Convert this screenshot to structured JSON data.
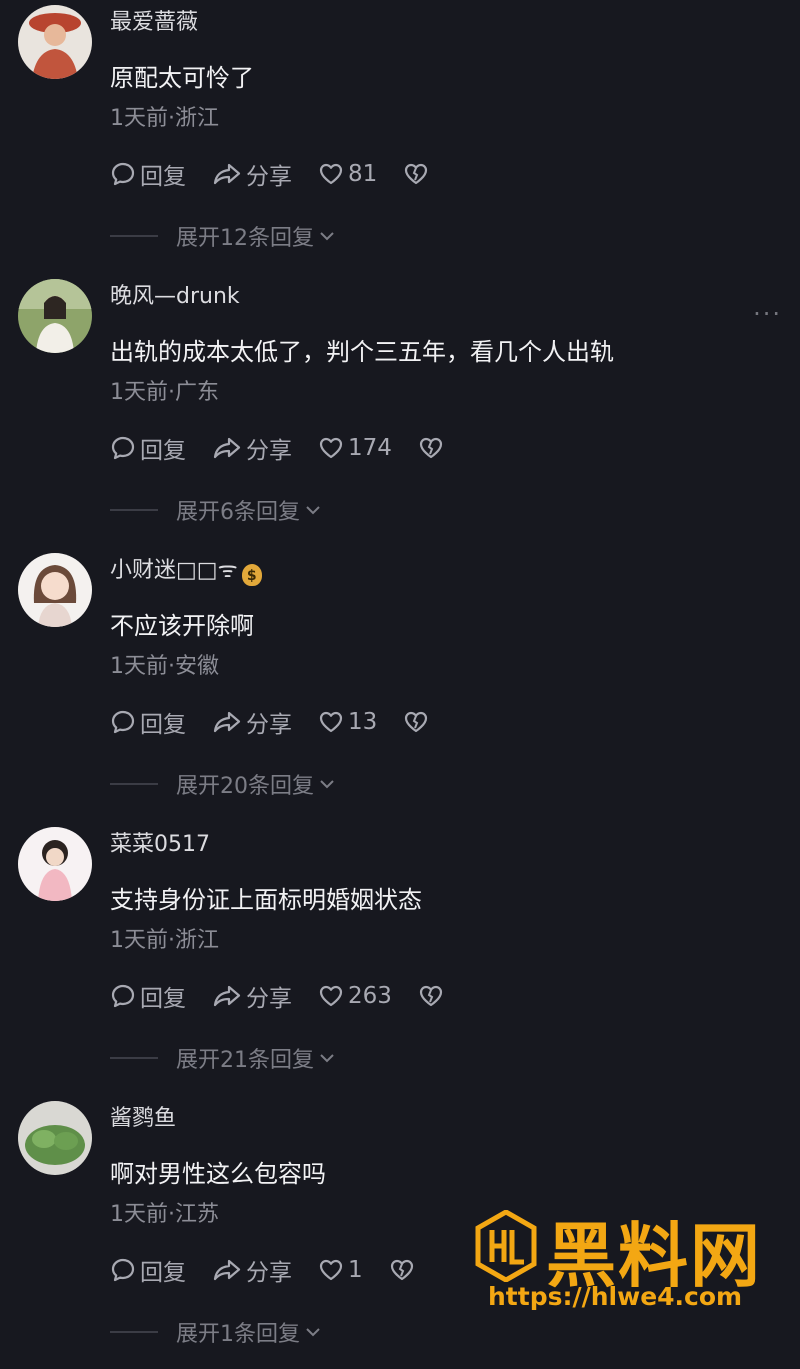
{
  "comments": [
    {
      "username": "最爱蔷薇",
      "text": "原配太可怜了",
      "meta": "1天前·浙江",
      "reply_label": "回复",
      "share_label": "分享",
      "likes": "81",
      "expand_label": "展开12条回复",
      "avatar_color": "#c1553d"
    },
    {
      "username": "晚风—drunk",
      "text": "出轨的成本太低了，判个三五年，看几个人出轨",
      "meta": "1天前·广东",
      "reply_label": "回复",
      "share_label": "分享",
      "likes": "174",
      "expand_label": "展开6条回复",
      "more": "···",
      "avatar_color": "#9aa872"
    },
    {
      "username": "小财迷",
      "username_suffix": "□□ᯤ",
      "text": "不应该开除啊",
      "meta": "1天前·安徽",
      "reply_label": "回复",
      "share_label": "分享",
      "likes": "13",
      "expand_label": "展开20条回复",
      "avatar_color": "#d9c8c2"
    },
    {
      "username": "菜菜0517",
      "text": "支持身份证上面标明婚姻状态",
      "meta": "1天前·浙江",
      "reply_label": "回复",
      "share_label": "分享",
      "likes": "263",
      "expand_label": "展开21条回复",
      "avatar_color": "#f3e3e6"
    },
    {
      "username": "酱鹨鱼",
      "text": "啊对男性这么包容吗",
      "meta": "1天前·江苏",
      "reply_label": "回复",
      "share_label": "分享",
      "likes": "1",
      "expand_label": "展开1条回复",
      "avatar_color": "#6f9a5a"
    }
  ],
  "watermark": {
    "title": "黑料网",
    "url": "https://hlwe4.com",
    "color": "#f3a713"
  },
  "icons": {
    "reply": "speech-bubble-icon",
    "share": "share-arrow-icon",
    "like": "heart-outline-icon",
    "dislike": "broken-heart-icon",
    "expand": "chevron-down-icon"
  }
}
